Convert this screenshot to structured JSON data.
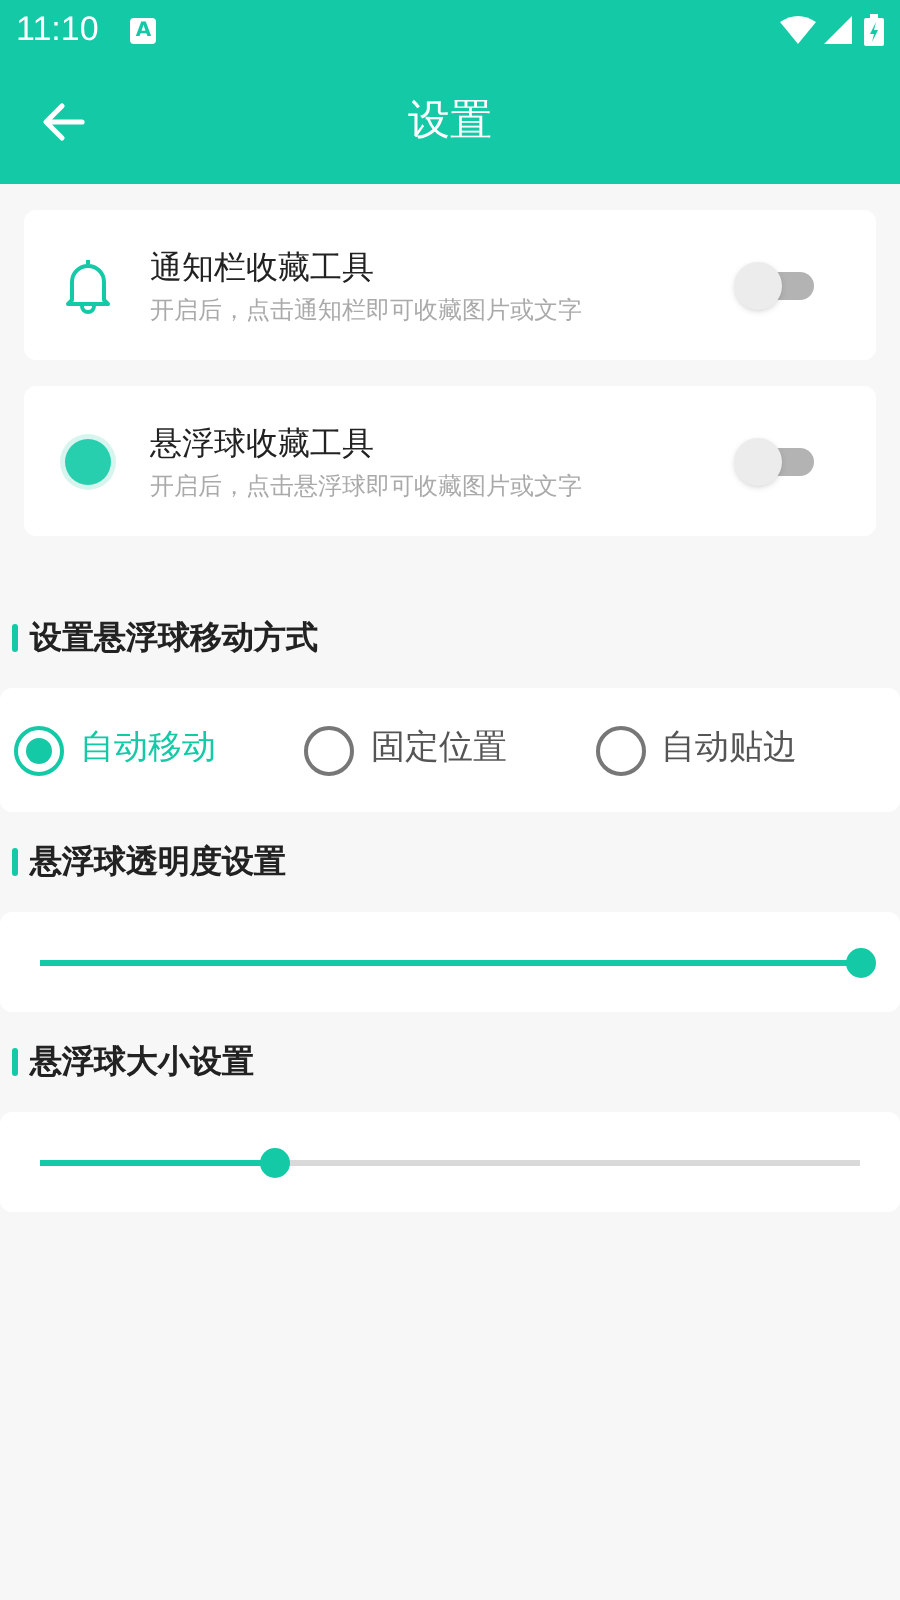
{
  "status_bar": {
    "time": "11:10",
    "badge": "A"
  },
  "app_bar": {
    "title": "设置"
  },
  "toggles": [
    {
      "kind": "bell",
      "title": "通知栏收藏工具",
      "subtitle": "开启后，点击通知栏即可收藏图片或文字",
      "on": false
    },
    {
      "kind": "ball",
      "title": "悬浮球收藏工具",
      "subtitle": "开启后，点击悬浮球即可收藏图片或文字",
      "on": false
    }
  ],
  "move_mode": {
    "heading": "设置悬浮球移动方式",
    "options": [
      {
        "label": "自动移动",
        "selected": true
      },
      {
        "label": "固定位置",
        "selected": false
      },
      {
        "label": "自动贴边",
        "selected": false
      }
    ]
  },
  "sliders": [
    {
      "heading": "悬浮球透明度设置",
      "level": 1
    },
    {
      "heading": "悬浮球大小设置",
      "level": 0.285
    }
  ]
}
